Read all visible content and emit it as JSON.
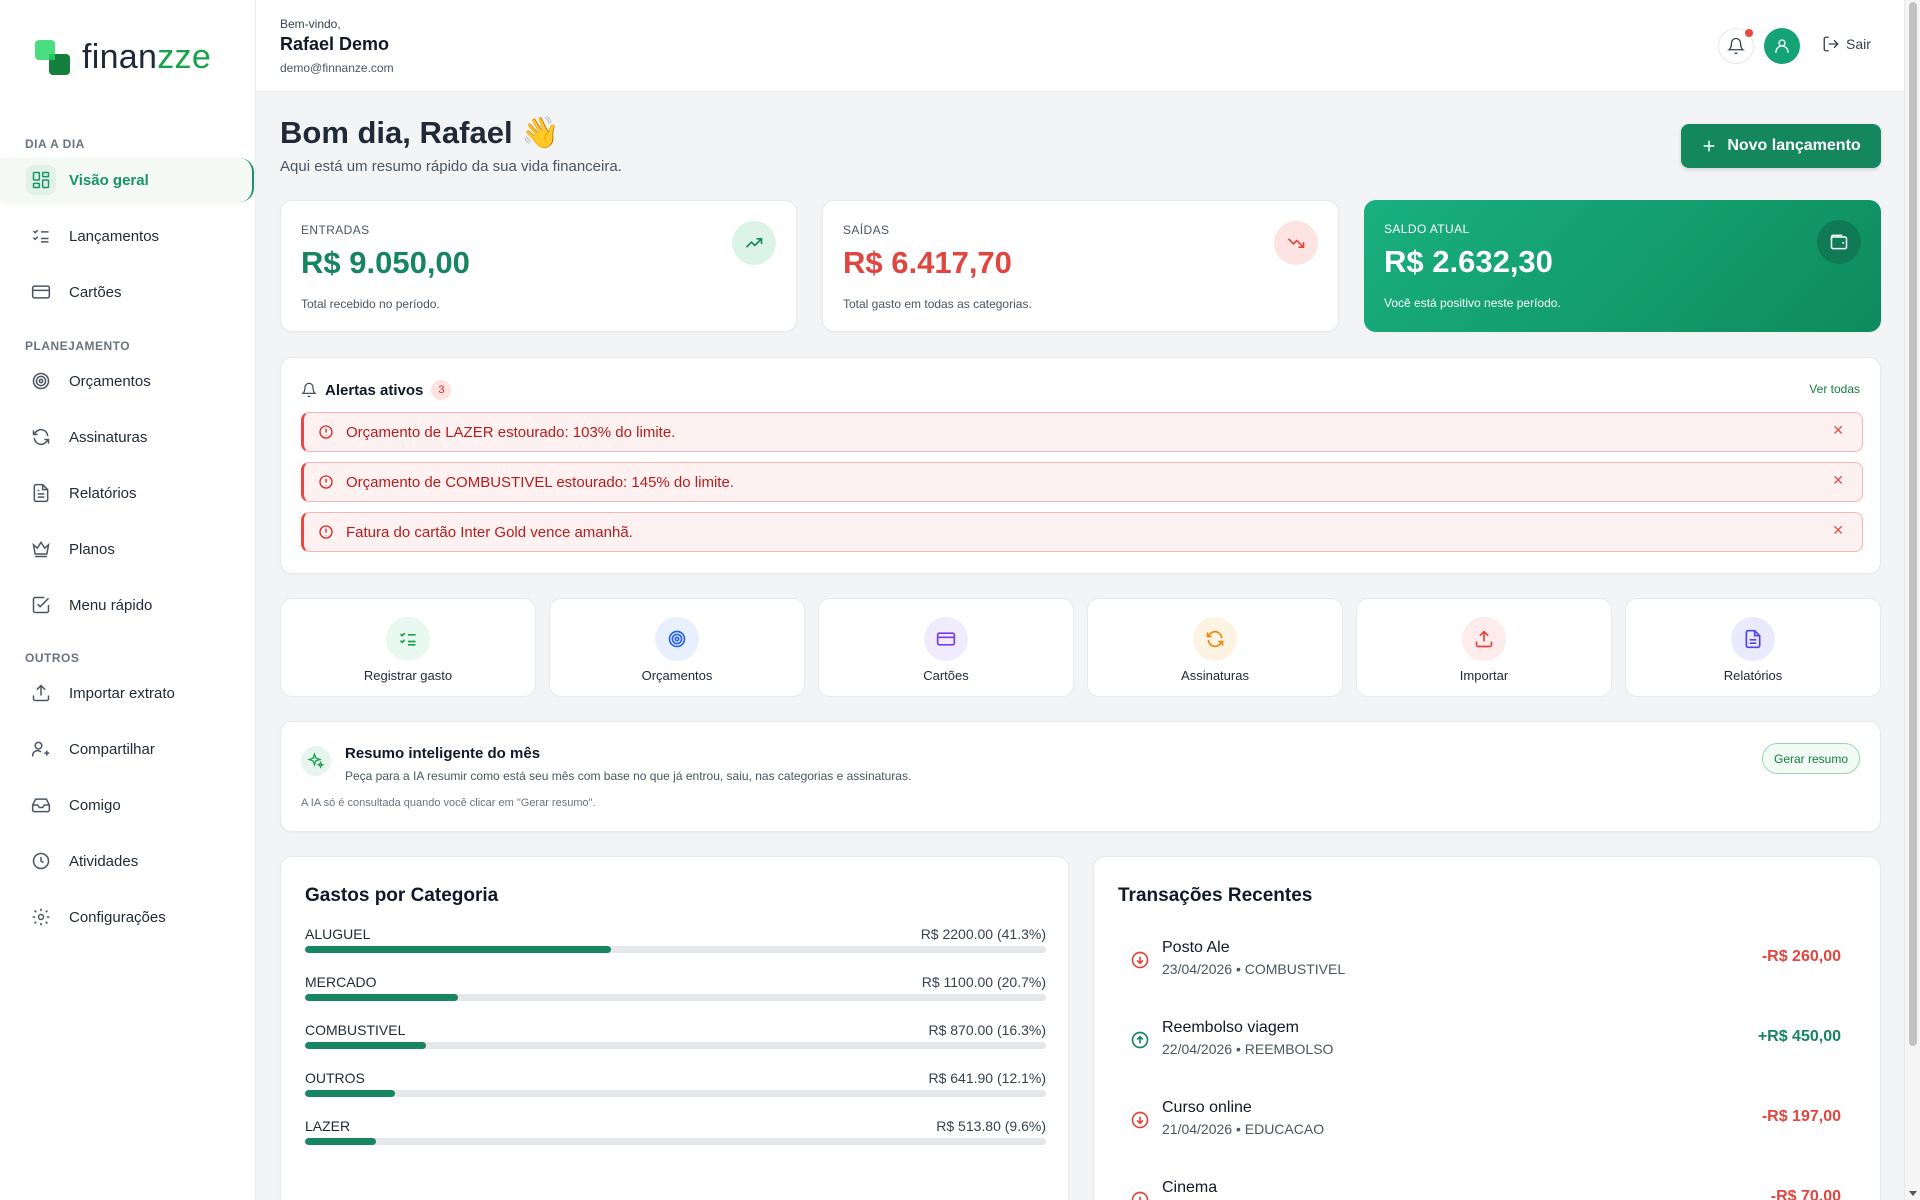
{
  "brand": {
    "name_start": "finan",
    "name_end": "zze",
    "accent": "#16a34a"
  },
  "sidebar": {
    "sections": [
      {
        "title": "DIA A DIA"
      },
      {
        "title": "PLANEJAMENTO"
      },
      {
        "title": "OUTROS"
      }
    ],
    "items": [
      {
        "label": "Visão geral",
        "icon": "dashboard-icon",
        "active": true
      },
      {
        "label": "Lançamentos",
        "icon": "list-check-icon"
      },
      {
        "label": "Cartões",
        "icon": "credit-card-icon"
      },
      {
        "label": "Orçamentos",
        "icon": "target-icon"
      },
      {
        "label": "Assinaturas",
        "icon": "refresh-icon"
      },
      {
        "label": "Relatórios",
        "icon": "file-text-icon"
      },
      {
        "label": "Planos",
        "icon": "crown-icon"
      },
      {
        "label": "Menu rápido",
        "icon": "check-square-icon"
      },
      {
        "label": "Importar extrato",
        "icon": "upload-icon"
      },
      {
        "label": "Compartilhar",
        "icon": "user-plus-icon"
      },
      {
        "label": "Comigo",
        "icon": "inbox-icon"
      },
      {
        "label": "Atividades",
        "icon": "clock-icon"
      },
      {
        "label": "Configurações",
        "icon": "gear-icon"
      }
    ]
  },
  "header": {
    "welcome": "Bem-vindo,",
    "name": "Rafael Demo",
    "email": "demo@finnanze.com",
    "logout_label": "Sair"
  },
  "main": {
    "greeting": "Bom dia, Rafael 👋",
    "subtitle": "Aqui está um resumo rápido da sua vida financeira.",
    "new_button": "Novo lançamento"
  },
  "stats": {
    "income": {
      "label": "ENTRADAS",
      "value": "R$ 9.050,00",
      "desc": "Total recebido no período.",
      "color": "#17855f"
    },
    "expense": {
      "label": "SAÍDAS",
      "value": "R$ 6.417,70",
      "desc": "Total gasto em todas as categorias.",
      "color": "#e0463f"
    },
    "balance": {
      "label": "SALDO ATUAL",
      "value": "R$ 2.632,30",
      "desc": "Você está positivo neste período."
    }
  },
  "alerts": {
    "title": "Alertas ativos",
    "count": "3",
    "see_all": "Ver todas",
    "items": [
      {
        "text": "Orçamento de LAZER estourado: 103% do limite."
      },
      {
        "text": "Orçamento de COMBUSTIVEL estourado: 145% do limite."
      },
      {
        "text": "Fatura do cartão Inter Gold vence amanhã."
      }
    ]
  },
  "quick_actions": [
    {
      "label": "Registrar gasto",
      "icon": "list-check-icon",
      "color": "#16a34a",
      "bg": "#e8f7ef"
    },
    {
      "label": "Orçamentos",
      "icon": "target-icon",
      "color": "#2563eb",
      "bg": "#e8effd"
    },
    {
      "label": "Cartões",
      "icon": "credit-card-icon",
      "color": "#7c3aed",
      "bg": "#f0ebfd"
    },
    {
      "label": "Assinaturas",
      "icon": "refresh-icon",
      "color": "#ea8a0c",
      "bg": "#fdf3e3"
    },
    {
      "label": "Importar",
      "icon": "upload-icon",
      "color": "#e0463f",
      "bg": "#fdeceb"
    },
    {
      "label": "Relatórios",
      "icon": "file-text-icon",
      "color": "#4f46e5",
      "bg": "#ebeafd"
    }
  ],
  "ai_summary": {
    "title": "Resumo inteligente do mês",
    "desc": "Peça para a IA resumir como está seu mês com base no que já entrou, saiu, nas categorias e assinaturas.",
    "note": "A IA só é consultada quando você clicar em \"Gerar resumo\".",
    "button": "Gerar resumo"
  },
  "categories": {
    "title": "Gastos por Categoria",
    "items": [
      {
        "name": "ALUGUEL",
        "value": "R$ 2200.00 (41.3%)",
        "pct": 41.3
      },
      {
        "name": "MERCADO",
        "value": "R$ 1100.00 (20.7%)",
        "pct": 20.7
      },
      {
        "name": "COMBUSTIVEL",
        "value": "R$ 870.00 (16.3%)",
        "pct": 16.3
      },
      {
        "name": "OUTROS",
        "value": "R$ 641.90 (12.1%)",
        "pct": 12.1
      },
      {
        "name": "LAZER",
        "value": "R$ 513.80 (9.6%)",
        "pct": 9.6
      }
    ]
  },
  "transactions": {
    "title": "Transações Recentes",
    "items": [
      {
        "name": "Posto Ale",
        "meta": "23/04/2026 • COMBUSTIVEL",
        "amount": "-R$ 260,00",
        "type": "out"
      },
      {
        "name": "Reembolso viagem",
        "meta": "22/04/2026 • REEMBOLSO",
        "amount": "+R$ 450,00",
        "type": "in"
      },
      {
        "name": "Curso online",
        "meta": "21/04/2026 • EDUCACAO",
        "amount": "-R$ 197,00",
        "type": "out"
      },
      {
        "name": "Cinema",
        "meta": "",
        "amount": "-R$ 70,00",
        "type": "out"
      }
    ]
  }
}
